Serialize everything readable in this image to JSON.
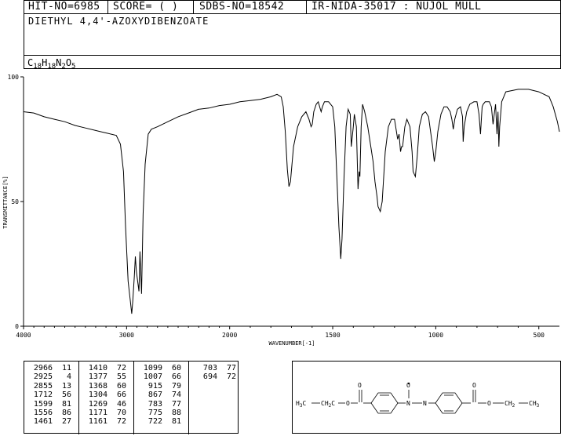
{
  "header": {
    "hit_no": "HIT-NO=6985",
    "score": "SCORE=  (   )",
    "sdbs_no": "SDBS-NO=18542",
    "ir_nida": "IR-NIDA-35017 : NUJOL MULL"
  },
  "compound": {
    "name": "DIETHYL 4,4'-AZOXYDIBENZOATE",
    "formula_parts": [
      {
        "t": "C",
        "sub": "18"
      },
      {
        "t": "H",
        "sub": "18"
      },
      {
        "t": "N",
        "sub": "2"
      },
      {
        "t": "O",
        "sub": "5"
      }
    ]
  },
  "chart_data": {
    "type": "line",
    "xlabel": "WAVENUMBER[-1]",
    "ylabel": "TRANSMITTANCE[%]",
    "xlim": [
      4000,
      400
    ],
    "ylim": [
      0,
      100
    ],
    "x_ticks": [
      4000,
      3000,
      2000,
      1500,
      1000,
      500
    ],
    "y_ticks": [
      0,
      50,
      100
    ],
    "grid": false,
    "series": [
      {
        "points": [
          [
            4000,
            86
          ],
          [
            3900,
            85.5
          ],
          [
            3800,
            84
          ],
          [
            3700,
            83
          ],
          [
            3600,
            82
          ],
          [
            3500,
            80.5
          ],
          [
            3400,
            79.5
          ],
          [
            3300,
            78.5
          ],
          [
            3200,
            77.5
          ],
          [
            3100,
            76.5
          ],
          [
            3060,
            73
          ],
          [
            3030,
            62
          ],
          [
            3010,
            40
          ],
          [
            2985,
            18
          ],
          [
            2966,
            11
          ],
          [
            2950,
            5
          ],
          [
            2940,
            10
          ],
          [
            2925,
            20
          ],
          [
            2915,
            28
          ],
          [
            2905,
            22
          ],
          [
            2880,
            14
          ],
          [
            2870,
            30
          ],
          [
            2855,
            13
          ],
          [
            2840,
            45
          ],
          [
            2820,
            65
          ],
          [
            2790,
            77
          ],
          [
            2760,
            79
          ],
          [
            2700,
            80
          ],
          [
            2600,
            82
          ],
          [
            2500,
            84
          ],
          [
            2400,
            85.5
          ],
          [
            2300,
            87
          ],
          [
            2200,
            87.5
          ],
          [
            2100,
            88.5
          ],
          [
            2000,
            89
          ],
          [
            1950,
            90
          ],
          [
            1900,
            90.5
          ],
          [
            1850,
            91
          ],
          [
            1800,
            92
          ],
          [
            1770,
            93
          ],
          [
            1750,
            92
          ],
          [
            1740,
            88
          ],
          [
            1730,
            78
          ],
          [
            1720,
            63
          ],
          [
            1712,
            56
          ],
          [
            1705,
            58
          ],
          [
            1690,
            72
          ],
          [
            1670,
            80
          ],
          [
            1650,
            84
          ],
          [
            1630,
            86
          ],
          [
            1615,
            83
          ],
          [
            1605,
            80
          ],
          [
            1599,
            81
          ],
          [
            1592,
            86
          ],
          [
            1580,
            89
          ],
          [
            1570,
            90
          ],
          [
            1560,
            87
          ],
          [
            1556,
            86
          ],
          [
            1550,
            88
          ],
          [
            1540,
            90
          ],
          [
            1520,
            90
          ],
          [
            1500,
            88
          ],
          [
            1490,
            80
          ],
          [
            1480,
            60
          ],
          [
            1470,
            40
          ],
          [
            1461,
            27
          ],
          [
            1455,
            35
          ],
          [
            1445,
            60
          ],
          [
            1435,
            80
          ],
          [
            1425,
            87
          ],
          [
            1415,
            85
          ],
          [
            1410,
            72
          ],
          [
            1400,
            80
          ],
          [
            1395,
            85
          ],
          [
            1385,
            80
          ],
          [
            1377,
            55
          ],
          [
            1372,
            62
          ],
          [
            1368,
            60
          ],
          [
            1362,
            80
          ],
          [
            1355,
            89
          ],
          [
            1345,
            86
          ],
          [
            1330,
            80
          ],
          [
            1315,
            72
          ],
          [
            1304,
            66
          ],
          [
            1295,
            58
          ],
          [
            1285,
            52
          ],
          [
            1280,
            48
          ],
          [
            1269,
            46
          ],
          [
            1260,
            50
          ],
          [
            1245,
            70
          ],
          [
            1230,
            80
          ],
          [
            1215,
            83
          ],
          [
            1200,
            83
          ],
          [
            1185,
            75
          ],
          [
            1178,
            77
          ],
          [
            1171,
            70
          ],
          [
            1166,
            72
          ],
          [
            1161,
            72
          ],
          [
            1150,
            80
          ],
          [
            1140,
            83
          ],
          [
            1125,
            80
          ],
          [
            1115,
            70
          ],
          [
            1110,
            62
          ],
          [
            1099,
            60
          ],
          [
            1090,
            68
          ],
          [
            1080,
            80
          ],
          [
            1065,
            85
          ],
          [
            1050,
            86
          ],
          [
            1035,
            84
          ],
          [
            1025,
            78
          ],
          [
            1015,
            72
          ],
          [
            1007,
            66
          ],
          [
            1000,
            70
          ],
          [
            990,
            78
          ],
          [
            975,
            85
          ],
          [
            960,
            88
          ],
          [
            945,
            88
          ],
          [
            930,
            86
          ],
          [
            922,
            83
          ],
          [
            915,
            79
          ],
          [
            908,
            83
          ],
          [
            895,
            87
          ],
          [
            880,
            88
          ],
          [
            870,
            84
          ],
          [
            867,
            74
          ],
          [
            862,
            80
          ],
          [
            850,
            86
          ],
          [
            835,
            89
          ],
          [
            815,
            90
          ],
          [
            800,
            90
          ],
          [
            790,
            85
          ],
          [
            783,
            77
          ],
          [
            778,
            84
          ],
          [
            775,
            88
          ],
          [
            770,
            89
          ],
          [
            760,
            90
          ],
          [
            740,
            90
          ],
          [
            730,
            88
          ],
          [
            722,
            81
          ],
          [
            715,
            86
          ],
          [
            710,
            89
          ],
          [
            703,
            77
          ],
          [
            698,
            86
          ],
          [
            694,
            72
          ],
          [
            690,
            80
          ],
          [
            680,
            90
          ],
          [
            660,
            94
          ],
          [
            600,
            95
          ],
          [
            550,
            95
          ],
          [
            500,
            94
          ],
          [
            450,
            92
          ],
          [
            430,
            88
          ],
          [
            410,
            82
          ],
          [
            400,
            78
          ]
        ]
      }
    ]
  },
  "peak_table": {
    "columns": [
      [
        [
          "2966",
          "11"
        ],
        [
          "2925",
          "4"
        ],
        [
          "2855",
          "13"
        ],
        [
          "1712",
          "56"
        ],
        [
          "1599",
          "81"
        ],
        [
          "1556",
          "86"
        ],
        [
          "1461",
          "27"
        ]
      ],
      [
        [
          "1410",
          "72"
        ],
        [
          "1377",
          "55"
        ],
        [
          "1368",
          "60"
        ],
        [
          "1304",
          "66"
        ],
        [
          "1269",
          "46"
        ],
        [
          "1171",
          "70"
        ],
        [
          "1161",
          "72"
        ]
      ],
      [
        [
          "1099",
          "60"
        ],
        [
          "1007",
          "66"
        ],
        [
          "915",
          "79"
        ],
        [
          "867",
          "74"
        ],
        [
          "783",
          "77"
        ],
        [
          "775",
          "88"
        ],
        [
          "722",
          "81"
        ]
      ],
      [
        [
          "703",
          "77"
        ],
        [
          "694",
          "72"
        ]
      ]
    ]
  },
  "structure": {
    "left_group": {
      "main": "H",
      "sub": "3",
      "tail": "C"
    },
    "ch2_left": {
      "main": "H",
      "sub": "2",
      "lead": "C",
      "tail": "C"
    },
    "carbonyl_o": "O",
    "ester_o": "O",
    "azoxy_o": "O",
    "n1": "N",
    "n2": "N",
    "ch2_right": {
      "lead": "CH",
      "sub": "2"
    },
    "right_group": {
      "lead": "CH",
      "sub": "3"
    }
  }
}
